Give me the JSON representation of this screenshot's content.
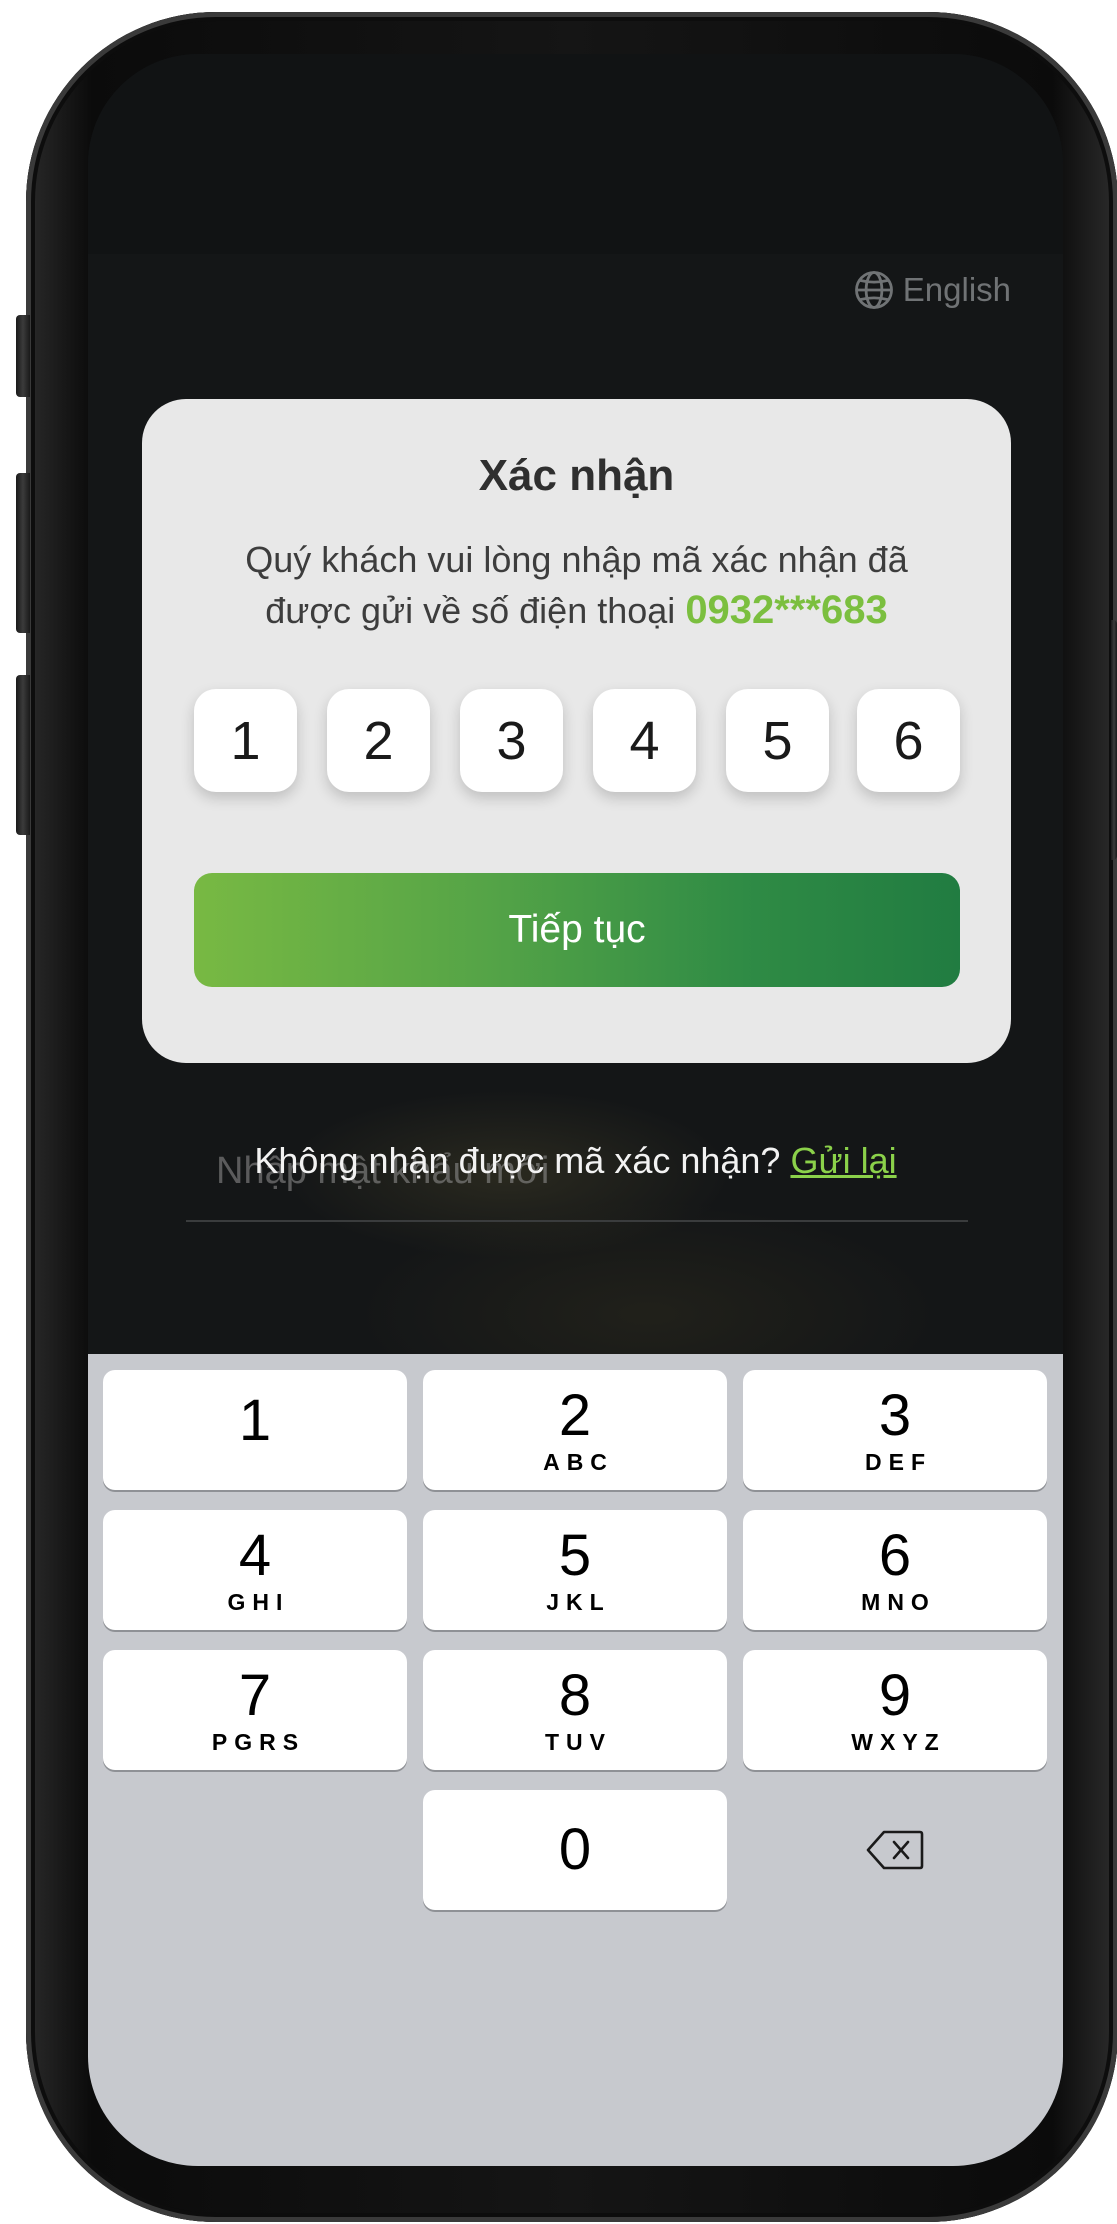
{
  "language_switch": {
    "label": "English",
    "icon": "globe-icon"
  },
  "modal": {
    "title": "Xác nhận",
    "description_line1": "Quý khách vui lòng nhập mã xác nhận đã",
    "description_line2": "được gửi về số điện thoại",
    "phone_masked": "0932***683",
    "otp_digits": [
      "1",
      "2",
      "3",
      "4",
      "5",
      "6"
    ],
    "continue_label": "Tiếp tục"
  },
  "background": {
    "password_placeholder": "Nhập mật khẩu mới"
  },
  "resend": {
    "prompt": "Không nhận được mã xác nhận?",
    "link_label": "Gửi lại"
  },
  "keypad": {
    "keys": [
      {
        "digit": "1",
        "letters": ""
      },
      {
        "digit": "2",
        "letters": "ABC"
      },
      {
        "digit": "3",
        "letters": "DEF"
      },
      {
        "digit": "4",
        "letters": "GHI"
      },
      {
        "digit": "5",
        "letters": "JKL"
      },
      {
        "digit": "6",
        "letters": "MNO"
      },
      {
        "digit": "7",
        "letters": "PGRS"
      },
      {
        "digit": "8",
        "letters": "TUV"
      },
      {
        "digit": "9",
        "letters": "WXYZ"
      },
      {
        "digit": "0",
        "letters": ""
      }
    ],
    "delete_icon": "backspace-icon"
  },
  "colors": {
    "accent_green": "#7bbf3f",
    "button_gradient_start": "#78b943",
    "button_gradient_end": "#217c41",
    "link_green": "#8bd14a"
  }
}
